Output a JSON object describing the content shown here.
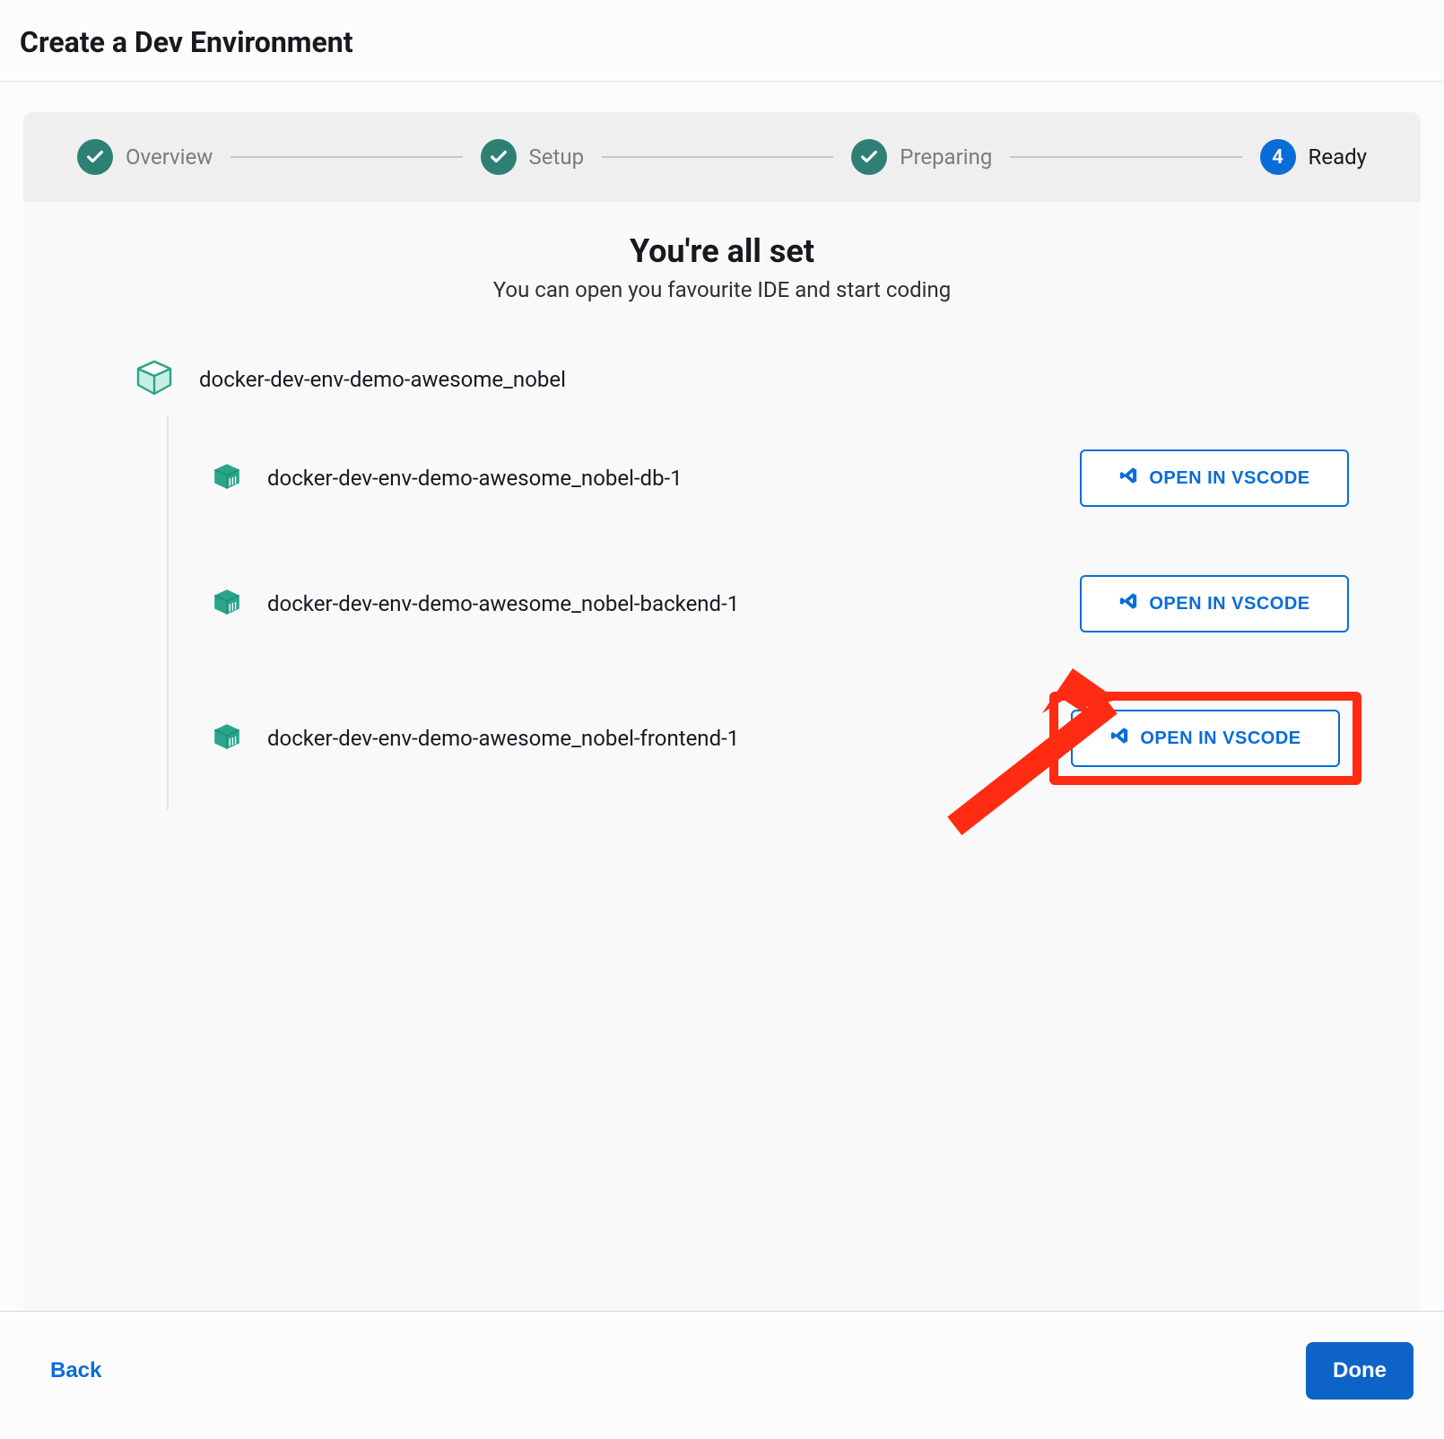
{
  "header": {
    "title": "Create a Dev Environment"
  },
  "stepper": {
    "steps": [
      {
        "label": "Overview",
        "state": "done"
      },
      {
        "label": "Setup",
        "state": "done"
      },
      {
        "label": "Preparing",
        "state": "done"
      },
      {
        "label": "Ready",
        "state": "active",
        "number": "4"
      }
    ]
  },
  "main": {
    "headline": "You're all set",
    "subhead": "You can open you favourite IDE and start coding",
    "env_name": "docker-dev-env-demo-awesome_nobel",
    "open_label": "OPEN IN VSCODE",
    "containers": [
      {
        "name": "docker-dev-env-demo-awesome_nobel-db-1",
        "highlighted": false
      },
      {
        "name": "docker-dev-env-demo-awesome_nobel-backend-1",
        "highlighted": false
      },
      {
        "name": "docker-dev-env-demo-awesome_nobel-frontend-1",
        "highlighted": true
      }
    ]
  },
  "footer": {
    "back_label": "Back",
    "done_label": "Done"
  },
  "icons": {
    "vscode": "vscode-icon",
    "container": "container-icon",
    "env": "package-icon",
    "check": "check-icon"
  }
}
